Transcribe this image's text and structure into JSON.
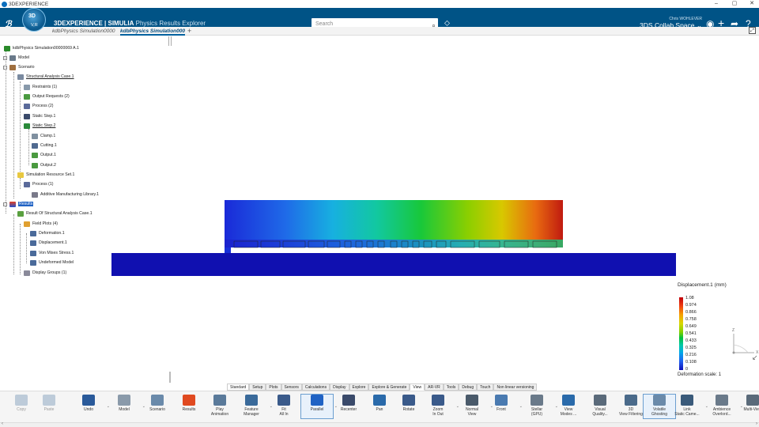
{
  "window": {
    "title": "3DEXPERIENCE",
    "controls": [
      "–",
      "▢",
      "✕"
    ]
  },
  "topbar": {
    "brand_bold": "3DEXPERIENCE | SIMULIA",
    "brand_app": "Physics Results Explorer",
    "compass_label": "V,R",
    "search_placeholder": "Search",
    "user_name": "Chris WOHLEVER",
    "collab_space": "3DS Collab Space ⌄"
  },
  "tabs": [
    {
      "label": "kdbPhysics Simulation0000"
    },
    {
      "label": "kdbPhysics Simulation000"
    },
    {
      "label": "+"
    }
  ],
  "tree": {
    "root": "kdbPhysics Simulation00000069 A.1",
    "nodes": [
      {
        "label": "Model"
      },
      {
        "label": "Scenario"
      },
      {
        "label": "Structural Analysis Case.1"
      },
      {
        "label": "Restraints (1)"
      },
      {
        "label": "Output Requests (2)"
      },
      {
        "label": "Process (2)"
      },
      {
        "label": "Static Step.1"
      },
      {
        "label": "Static Step.2"
      },
      {
        "label": "Clamp.1"
      },
      {
        "label": "Cutting.1"
      },
      {
        "label": "Output.1"
      },
      {
        "label": "Output.2"
      },
      {
        "label": "Simulation Resource Set.1"
      },
      {
        "label": "Process (1)"
      },
      {
        "label": "Additive Manufacturing Library.1"
      },
      {
        "label": "Results"
      },
      {
        "label": "Result Of Structural Analysis Case.1"
      },
      {
        "label": "Field Plots (4)"
      },
      {
        "label": "Deformation.1"
      },
      {
        "label": "Displacement.1"
      },
      {
        "label": "Von Mises Stress.1"
      },
      {
        "label": "Undeformed Model"
      },
      {
        "label": "Display Groups (1)"
      }
    ]
  },
  "legend": {
    "title": "Displacement.1 (mm)",
    "values": [
      "1.08",
      "0.974",
      "0.866",
      "0.758",
      "0.649",
      "0.541",
      "0.433",
      "0.325",
      "0.216",
      "0.108",
      "0"
    ],
    "deformation_scale": "Deformation scale: 1"
  },
  "axes": {
    "z": "Z",
    "x": "X"
  },
  "bottom_tabs": [
    "Standard",
    "Setup",
    "Plots",
    "Sensors",
    "Calculations",
    "Display",
    "Explore",
    "Explore & Generate",
    "View",
    "AR-VR",
    "Tools",
    "Debug",
    "Touch",
    "Non linear versioning"
  ],
  "active_bottom_tab": "View",
  "toolbar": [
    {
      "label": "Copy",
      "icon": "copy-icon",
      "disabled": true
    },
    {
      "label": "Paste",
      "icon": "paste-icon",
      "disabled": true
    },
    {
      "label": "Undo",
      "icon": "undo-icon"
    },
    {
      "label": "Model",
      "icon": "model-icon"
    },
    {
      "label": "Scenario",
      "icon": "scenario-icon"
    },
    {
      "label": "Results",
      "icon": "results-icon"
    },
    {
      "label": "Play\nAnimation",
      "icon": "play-animation-icon"
    },
    {
      "label": "Feature\nManager",
      "icon": "feature-manager-icon"
    },
    {
      "label": "Fit\nAll In",
      "icon": "fit-all-icon"
    },
    {
      "label": "Parallel",
      "icon": "parallel-icon"
    },
    {
      "label": "Recenter",
      "icon": "recenter-icon"
    },
    {
      "label": "Pan",
      "icon": "pan-icon"
    },
    {
      "label": "Rotate",
      "icon": "rotate-icon"
    },
    {
      "label": "Zoom\nIn Out",
      "icon": "zoom-icon"
    },
    {
      "label": "Normal\nView",
      "icon": "normal-view-icon"
    },
    {
      "label": "Front",
      "icon": "front-view-icon"
    },
    {
      "label": "Stellar\n(GPU)",
      "icon": "stellar-icon"
    },
    {
      "label": "View\nModes ...",
      "icon": "view-modes-icon"
    },
    {
      "label": "Visual\nQuality...",
      "icon": "visual-quality-icon"
    },
    {
      "label": "3D\nView Filtering",
      "icon": "view-filtering-icon"
    },
    {
      "label": "Volatile\nGhosting",
      "icon": "volatile-ghosting-icon"
    },
    {
      "label": "Link\nStatic Came...",
      "icon": "link-camera-icon"
    },
    {
      "label": "Ambience\nOverlord...",
      "icon": "ambience-icon"
    },
    {
      "label": "Multi-View",
      "icon": "multi-view-icon"
    }
  ]
}
